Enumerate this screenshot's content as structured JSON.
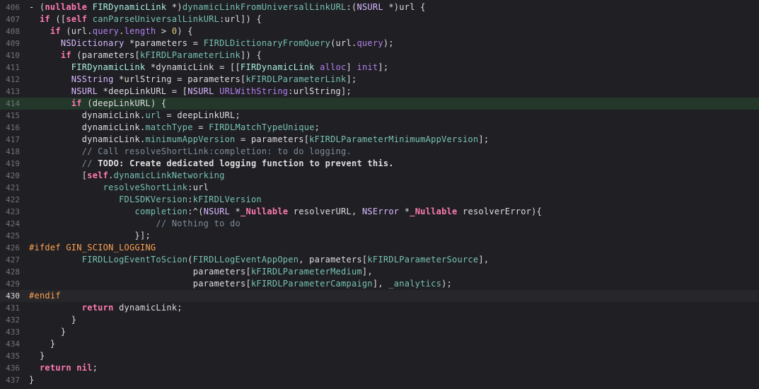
{
  "editor": {
    "highlighted_line": 414,
    "current_line": 430,
    "lines": [
      {
        "n": "406",
        "indent": 0,
        "tokens": [
          [
            "plain",
            "- ("
          ],
          [
            "kw",
            "nullable"
          ],
          [
            "plain",
            " "
          ],
          [
            "projtype",
            "FIRDynamicLink"
          ],
          [
            "plain",
            " *)"
          ],
          [
            "projfn",
            "dynamicLinkFromUniversalLinkURL"
          ],
          [
            "plain",
            ":("
          ],
          [
            "type",
            "NSURL"
          ],
          [
            "plain",
            " *)url {"
          ]
        ]
      },
      {
        "n": "407",
        "indent": 2,
        "tokens": [
          [
            "kw",
            "if"
          ],
          [
            "plain",
            " (["
          ],
          [
            "kw",
            "self"
          ],
          [
            "plain",
            " "
          ],
          [
            "projfn",
            "canParseUniversalLinkURL"
          ],
          [
            "plain",
            ":url]) {"
          ]
        ]
      },
      {
        "n": "408",
        "indent": 4,
        "tokens": [
          [
            "kw",
            "if"
          ],
          [
            "plain",
            " (url."
          ],
          [
            "method",
            "query"
          ],
          [
            "plain",
            "."
          ],
          [
            "method",
            "length"
          ],
          [
            "plain",
            " > "
          ],
          [
            "num",
            "0"
          ],
          [
            "plain",
            ") {"
          ]
        ]
      },
      {
        "n": "409",
        "indent": 6,
        "tokens": [
          [
            "type",
            "NSDictionary"
          ],
          [
            "plain",
            " *parameters = "
          ],
          [
            "projfn",
            "FIRDLDictionaryFromQuery"
          ],
          [
            "plain",
            "(url."
          ],
          [
            "method",
            "query"
          ],
          [
            "plain",
            ");"
          ]
        ]
      },
      {
        "n": "410",
        "indent": 6,
        "tokens": [
          [
            "kw",
            "if"
          ],
          [
            "plain",
            " (parameters["
          ],
          [
            "projfn",
            "kFIRDLParameterLink"
          ],
          [
            "plain",
            "]) {"
          ]
        ]
      },
      {
        "n": "411",
        "indent": 8,
        "tokens": [
          [
            "projtype",
            "FIRDynamicLink"
          ],
          [
            "plain",
            " *dynamicLink = [["
          ],
          [
            "projtype",
            "FIRDynamicLink"
          ],
          [
            "plain",
            " "
          ],
          [
            "method",
            "alloc"
          ],
          [
            "plain",
            "] "
          ],
          [
            "method",
            "init"
          ],
          [
            "plain",
            "];"
          ]
        ]
      },
      {
        "n": "412",
        "indent": 8,
        "tokens": [
          [
            "type",
            "NSString"
          ],
          [
            "plain",
            " *urlString = parameters["
          ],
          [
            "projfn",
            "kFIRDLParameterLink"
          ],
          [
            "plain",
            "];"
          ]
        ]
      },
      {
        "n": "413",
        "indent": 8,
        "tokens": [
          [
            "type",
            "NSURL"
          ],
          [
            "plain",
            " *deepLinkURL = ["
          ],
          [
            "type",
            "NSURL"
          ],
          [
            "plain",
            " "
          ],
          [
            "method",
            "URLWithString"
          ],
          [
            "plain",
            ":urlString];"
          ]
        ]
      },
      {
        "n": "414",
        "indent": 8,
        "tokens": [
          [
            "kw",
            "if"
          ],
          [
            "plain",
            " ("
          ],
          [
            "underline",
            "deepLinkURL"
          ],
          [
            "plain",
            ") {"
          ]
        ]
      },
      {
        "n": "415",
        "indent": 10,
        "tokens": [
          [
            "plain",
            "dynamicLink."
          ],
          [
            "projfn",
            "url"
          ],
          [
            "plain",
            " = deepLinkURL;"
          ]
        ]
      },
      {
        "n": "416",
        "indent": 10,
        "tokens": [
          [
            "plain",
            "dynamicLink."
          ],
          [
            "projfn",
            "matchType"
          ],
          [
            "plain",
            " = "
          ],
          [
            "projfn",
            "FIRDLMatchTypeUnique"
          ],
          [
            "plain",
            ";"
          ]
        ]
      },
      {
        "n": "417",
        "indent": 10,
        "tokens": [
          [
            "plain",
            "dynamicLink."
          ],
          [
            "projfn",
            "minimumAppVersion"
          ],
          [
            "plain",
            " = parameters["
          ],
          [
            "projfn",
            "kFIRDLParameterMinimumAppVersion"
          ],
          [
            "plain",
            "];"
          ]
        ]
      },
      {
        "n": "418",
        "indent": 10,
        "tokens": [
          [
            "comment",
            "// Call resolveShortLink:completion: to do logging."
          ]
        ]
      },
      {
        "n": "419",
        "indent": 10,
        "tokens": [
          [
            "comment",
            "// "
          ],
          [
            "bold",
            "TODO: Create dedicated logging function to prevent this."
          ]
        ]
      },
      {
        "n": "420",
        "indent": 10,
        "tokens": [
          [
            "plain",
            "["
          ],
          [
            "kw",
            "self"
          ],
          [
            "plain",
            "."
          ],
          [
            "projfn",
            "dynamicLinkNetworking"
          ]
        ]
      },
      {
        "n": "421",
        "indent": 14,
        "tokens": [
          [
            "projfn",
            "resolveShortLink"
          ],
          [
            "plain",
            ":url"
          ]
        ]
      },
      {
        "n": "422",
        "indent": 17,
        "tokens": [
          [
            "projfn",
            "FDLSDKVersion"
          ],
          [
            "plain",
            ":"
          ],
          [
            "projfn",
            "kFIRDLVersion"
          ]
        ]
      },
      {
        "n": "423",
        "indent": 20,
        "tokens": [
          [
            "projfn",
            "completion"
          ],
          [
            "plain",
            ":^("
          ],
          [
            "type",
            "NSURL"
          ],
          [
            "plain",
            " *"
          ],
          [
            "kw",
            "_Nullable"
          ],
          [
            "plain",
            " resolverURL, "
          ],
          [
            "type",
            "NSError"
          ],
          [
            "plain",
            " *"
          ],
          [
            "kw",
            "_Nullable"
          ],
          [
            "plain",
            " resolverError){"
          ]
        ]
      },
      {
        "n": "424",
        "indent": 24,
        "tokens": [
          [
            "comment",
            "// Nothing to do"
          ]
        ]
      },
      {
        "n": "425",
        "indent": 20,
        "tokens": [
          [
            "plain",
            "}];"
          ]
        ]
      },
      {
        "n": "426",
        "indent": 0,
        "tokens": [
          [
            "macro",
            "#ifdef GIN_SCION_LOGGING"
          ]
        ]
      },
      {
        "n": "427",
        "indent": 10,
        "tokens": [
          [
            "projfn",
            "FIRDLLogEventToScion"
          ],
          [
            "plain",
            "("
          ],
          [
            "projfn",
            "FIRDLLogEventAppOpen"
          ],
          [
            "plain",
            ", parameters["
          ],
          [
            "projfn",
            "kFIRDLParameterSource"
          ],
          [
            "plain",
            "],"
          ]
        ]
      },
      {
        "n": "428",
        "indent": 31,
        "tokens": [
          [
            "plain",
            "parameters["
          ],
          [
            "projfn",
            "kFIRDLParameterMedium"
          ],
          [
            "plain",
            "],"
          ]
        ]
      },
      {
        "n": "429",
        "indent": 31,
        "tokens": [
          [
            "plain",
            "parameters["
          ],
          [
            "projfn",
            "kFIRDLParameterCampaign"
          ],
          [
            "plain",
            "], "
          ],
          [
            "projfn",
            "_analytics"
          ],
          [
            "plain",
            ");"
          ]
        ]
      },
      {
        "n": "430",
        "indent": 0,
        "tokens": [
          [
            "macro",
            "#endif"
          ]
        ]
      },
      {
        "n": "431",
        "indent": 10,
        "tokens": [
          [
            "kw",
            "return"
          ],
          [
            "plain",
            " dynamicLink;"
          ]
        ]
      },
      {
        "n": "432",
        "indent": 8,
        "tokens": [
          [
            "plain",
            "}"
          ]
        ]
      },
      {
        "n": "433",
        "indent": 6,
        "tokens": [
          [
            "plain",
            "}"
          ]
        ]
      },
      {
        "n": "434",
        "indent": 4,
        "tokens": [
          [
            "plain",
            "}"
          ]
        ]
      },
      {
        "n": "435",
        "indent": 2,
        "tokens": [
          [
            "plain",
            "}"
          ]
        ]
      },
      {
        "n": "436",
        "indent": 2,
        "tokens": [
          [
            "kw",
            "return"
          ],
          [
            "plain",
            " "
          ],
          [
            "kw",
            "nil"
          ],
          [
            "plain",
            ";"
          ]
        ]
      },
      {
        "n": "437",
        "indent": 0,
        "tokens": [
          [
            "plain",
            "}"
          ]
        ]
      }
    ]
  },
  "colors": {
    "background": "#1f1f24",
    "highlight_line": "#23372a",
    "current_line": "#26262b",
    "keyword": "#ff7ab2",
    "system_type": "#dabaff",
    "system_method": "#b281eb",
    "project_type": "#acf2e4",
    "project_function": "#78c2b3",
    "comment": "#7f8c98",
    "preprocessor": "#ffa14f",
    "number": "#d9c97c",
    "plain": "#dfdfe0"
  }
}
